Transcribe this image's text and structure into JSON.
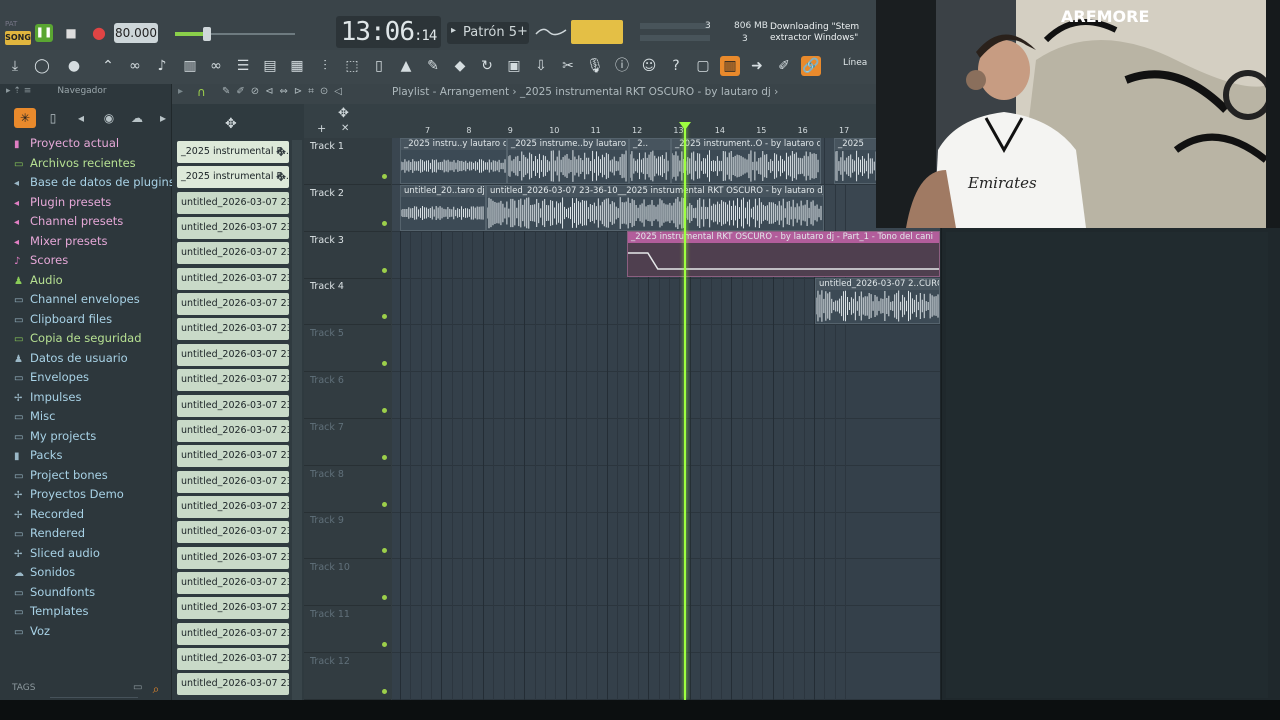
{
  "toolbar": {
    "song_label": "SONG",
    "pat_label": "PAT",
    "tempo": "80.000",
    "time_main": "13:06",
    "time_sub": ":14",
    "pattern": "Patrón 5",
    "cpu_top": "3",
    "mem": "806 MB",
    "cpu_bottom": "3",
    "hint_line1": "Downloading \"Stem",
    "hint_line2": "extractor Windows\"",
    "snap": "Línea",
    "accent": "#e98a2c"
  },
  "browser": {
    "header": "Navegador",
    "items": [
      {
        "label": "Proyecto actual",
        "icon": "project-icon",
        "tone": "pink"
      },
      {
        "label": "Archivos recientes",
        "icon": "recent-folder-icon",
        "tone": "green"
      },
      {
        "label": "Base de datos de plugins",
        "icon": "plugin-db-icon",
        "tone": "blue"
      },
      {
        "label": "Plugin presets",
        "icon": "plugin-preset-icon",
        "tone": "pink"
      },
      {
        "label": "Channel presets",
        "icon": "channel-preset-icon",
        "tone": "pink"
      },
      {
        "label": "Mixer presets",
        "icon": "mixer-preset-icon",
        "tone": "pink"
      },
      {
        "label": "Scores",
        "icon": "score-icon",
        "tone": "pink"
      },
      {
        "label": "Audio",
        "icon": "audio-icon",
        "tone": "green"
      },
      {
        "label": "Channel envelopes",
        "icon": "folder-icon",
        "tone": "blue"
      },
      {
        "label": "Clipboard files",
        "icon": "folder-icon",
        "tone": "blue"
      },
      {
        "label": "Copia de seguridad",
        "icon": "backup-icon",
        "tone": "green"
      },
      {
        "label": "Datos de usuario",
        "icon": "user-data-icon",
        "tone": "blue"
      },
      {
        "label": "Envelopes",
        "icon": "envelope-icon",
        "tone": "blue"
      },
      {
        "label": "Impulses",
        "icon": "impulse-icon",
        "tone": "blue"
      },
      {
        "label": "Misc",
        "icon": "folder-icon",
        "tone": "blue"
      },
      {
        "label": "My projects",
        "icon": "folder-icon",
        "tone": "blue"
      },
      {
        "label": "Packs",
        "icon": "packs-icon",
        "tone": "blue"
      },
      {
        "label": "Project bones",
        "icon": "folder-icon",
        "tone": "blue"
      },
      {
        "label": "Proyectos Demo",
        "icon": "demo-icon",
        "tone": "blue"
      },
      {
        "label": "Recorded",
        "icon": "recorded-icon",
        "tone": "blue"
      },
      {
        "label": "Rendered",
        "icon": "folder-icon",
        "tone": "blue"
      },
      {
        "label": "Sliced audio",
        "icon": "sliced-icon",
        "tone": "blue"
      },
      {
        "label": "Sonidos",
        "icon": "cloud-icon",
        "tone": "blue"
      },
      {
        "label": "Soundfonts",
        "icon": "folder-icon",
        "tone": "blue"
      },
      {
        "label": "Templates",
        "icon": "folder-icon",
        "tone": "blue"
      },
      {
        "label": "Voz",
        "icon": "folder-icon",
        "tone": "blue"
      }
    ],
    "tags_label": "TAGS"
  },
  "picker": {
    "clips": [
      "_2025 instrumental R...",
      "_2025 instrumental R...",
      "untitled_2026-03-07 23-...",
      "untitled_2026-03-07 23-...",
      "untitled_2026-03-07 23-...",
      "untitled_2026-03-07 23-...",
      "untitled_2026-03-07 23-...",
      "untitled_2026-03-07 23-...",
      "untitled_2026-03-07 23-...",
      "untitled_2026-03-07 23-...",
      "untitled_2026-03-07 23-...",
      "untitled_2026-03-07 23-...",
      "untitled_2026-03-07 23-...",
      "untitled_2026-03-07 23-...",
      "untitled_2026-03-07 23-...",
      "untitled_2026-03-07 23-...",
      "untitled_2026-03-07 23-...",
      "untitled_2026-03-07 23-...",
      "untitled_2026-03-07 23-...",
      "untitled_2026-03-07 23-...",
      "untitled_2026-03-07 23-...",
      "untitled_2026-03-07 23-..."
    ]
  },
  "playlist": {
    "title": "Playlist - Arrangement › _2025 instrumental RKT OSCURO - by lautaro dj ›",
    "ruler": [
      "7",
      "8",
      "9",
      "10",
      "11",
      "12",
      "13",
      "14",
      "15",
      "16",
      "17"
    ],
    "tracks": [
      "Track 1",
      "Track 2",
      "Track 3",
      "Track 4",
      "Track 5",
      "Track 6",
      "Track 7",
      "Track 8",
      "Track 9",
      "Track 10",
      "Track 11",
      "Track 12"
    ],
    "clips_row1": [
      "_2025 instru..y lautaro dj",
      "_2025 instrume..by lautaro dj",
      "_2..",
      "_2025 instrument..O - by lautaro dj",
      "_2025"
    ],
    "clips_row2": [
      "untitled_20..taro dj",
      "untitled_2026-03-07 23-36-10__2025 instrumental RKT OSCURO - by lautaro dj"
    ],
    "clip_row3": "_2025 instrumental RKT OSCURO - by lautaro dj - Part_1 - Tono del cani",
    "clip_row4": "untitled_2026-03-07 2..CURO -"
  }
}
